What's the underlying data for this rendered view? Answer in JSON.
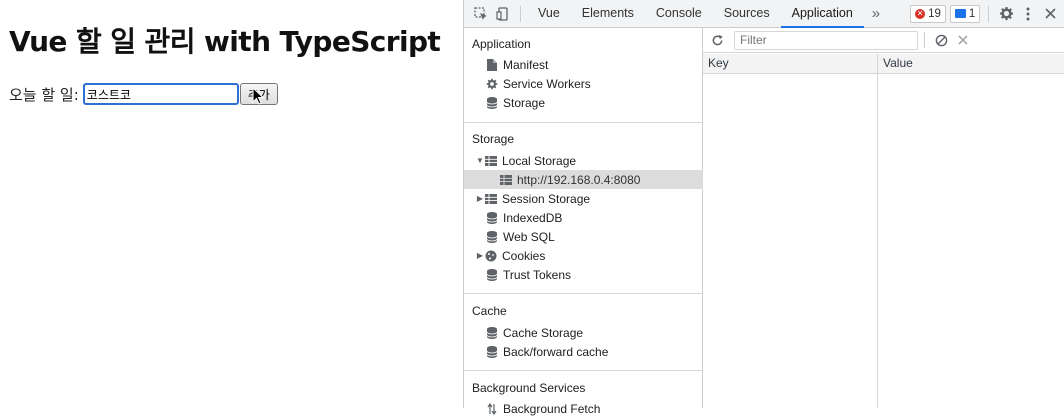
{
  "app": {
    "title": "Vue 할 일 관리 with TypeScript",
    "todo_label": "오늘 할 일:",
    "todo_value": "코스트코",
    "add_button": "추가"
  },
  "devtools": {
    "tabs": [
      "Vue",
      "Elements",
      "Console",
      "Sources",
      "Application"
    ],
    "active_tab": "Application",
    "more": "»",
    "error_count": "19",
    "message_count": "1",
    "sidebar": {
      "application_title": "Application",
      "application_items": [
        "Manifest",
        "Service Workers",
        "Storage"
      ],
      "storage_title": "Storage",
      "local_storage": "Local Storage",
      "local_storage_origin": "http://192.168.0.4:8080",
      "session_storage": "Session Storage",
      "indexeddb": "IndexedDB",
      "websql": "Web SQL",
      "cookies": "Cookies",
      "trust_tokens": "Trust Tokens",
      "cache_title": "Cache",
      "cache_items": [
        "Cache Storage",
        "Back/forward cache"
      ],
      "background_title": "Background Services",
      "background_first_item": "Background Fetch"
    },
    "pane": {
      "filter_placeholder": "Filter",
      "columns": [
        "Key",
        "Value"
      ]
    }
  }
}
